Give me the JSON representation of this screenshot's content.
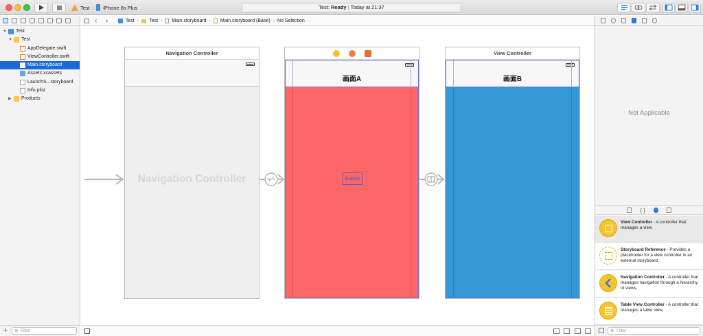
{
  "toolbar": {
    "scheme_name": "Test",
    "device_name": "iPhone 6s Plus",
    "status_project": "Test:",
    "status_state": "Ready",
    "status_time": "Today at 21:37"
  },
  "navigator": {
    "items": [
      {
        "label": "Test",
        "kind": "project"
      },
      {
        "label": "Test",
        "kind": "folder"
      },
      {
        "label": "AppDelegate.swift",
        "kind": "swift"
      },
      {
        "label": "ViewController.swift",
        "kind": "swift"
      },
      {
        "label": "Main.storyboard",
        "kind": "storyboard",
        "selected": true
      },
      {
        "label": "Assets.xcassets",
        "kind": "assets"
      },
      {
        "label": "LaunchS...storyboard",
        "kind": "storyboard"
      },
      {
        "label": "Info.plist",
        "kind": "plist"
      },
      {
        "label": "Products",
        "kind": "folder"
      }
    ],
    "filter_placeholder": "Filter"
  },
  "jumpbar": {
    "crumbs": [
      "Test",
      "Test",
      "Main.storyboard",
      "Main.storyboard (Base)",
      "No Selection"
    ]
  },
  "canvas": {
    "nav_controller_title": "Navigation Controller",
    "nav_controller_placeholder": "Navigation Controller",
    "scene_a_title": "画面A",
    "scene_a_button": "Button",
    "view_controller_title": "View Controller",
    "scene_b_title": "画面B"
  },
  "inspector": {
    "not_applicable": "Not Applicable",
    "library": [
      {
        "title": "View Controller",
        "desc": " - A controller that manages a view."
      },
      {
        "title": "Storyboard Reference",
        "desc": " - Provides a placeholder for a view controller in an external storyboard."
      },
      {
        "title": "Navigation Controller",
        "desc": " - A controller that manages navigation through a hierarchy of views."
      },
      {
        "title": "Table View Controller",
        "desc": " - A controller that manages a table view."
      }
    ],
    "filter_placeholder": "Filter"
  },
  "colors": {
    "scene_a_bg": "#ff6666",
    "scene_b_bg": "#3399d6",
    "selection": "#1a6ad8"
  }
}
